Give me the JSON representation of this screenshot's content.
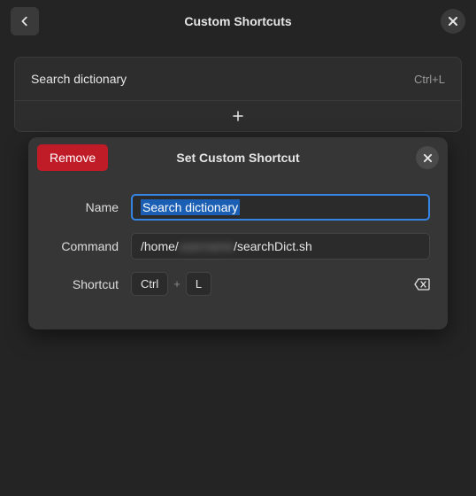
{
  "header": {
    "title": "Custom Shortcuts"
  },
  "list": {
    "item": {
      "name": "Search dictionary",
      "shortcut": "Ctrl+L"
    }
  },
  "dialog": {
    "remove_label": "Remove",
    "title": "Set Custom Shortcut",
    "name_label": "Name",
    "name_value": "Search dictionary",
    "command_label": "Command",
    "command_prefix": "/home/",
    "command_hidden": "username",
    "command_suffix": "/searchDict.sh",
    "shortcut_label": "Shortcut",
    "keys": [
      "Ctrl",
      "L"
    ]
  }
}
